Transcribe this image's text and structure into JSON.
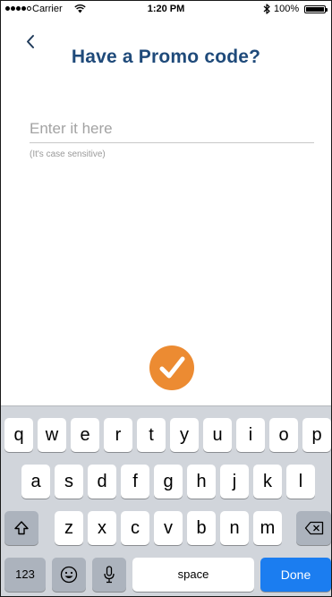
{
  "status_bar": {
    "carrier": "Carrier",
    "time": "1:20 PM",
    "battery": "100%",
    "signal_icon": "signal-dots-icon",
    "wifi_icon": "wifi-icon",
    "bluetooth_icon": "bluetooth-icon",
    "battery_icon": "battery-icon"
  },
  "header": {
    "back_icon": "chevron-left-icon",
    "title": "Have a Promo code?"
  },
  "promo": {
    "placeholder": "Enter it here",
    "value": "",
    "helper": "(It's case sensitive)"
  },
  "submit": {
    "icon": "checkmark-icon",
    "color": "#ec8b32"
  },
  "keyboard": {
    "row1": [
      "q",
      "w",
      "e",
      "r",
      "t",
      "y",
      "u",
      "i",
      "o",
      "p"
    ],
    "row2": [
      "a",
      "s",
      "d",
      "f",
      "g",
      "h",
      "j",
      "k",
      "l"
    ],
    "row3": [
      "z",
      "x",
      "c",
      "v",
      "b",
      "n",
      "m"
    ],
    "shift_icon": "shift-arrow-icon",
    "delete_icon": "backspace-icon",
    "numbers_label": "123",
    "emoji_icon": "emoji-icon",
    "mic_icon": "microphone-icon",
    "space_label": "space",
    "done_label": "Done",
    "done_color": "#1b7df0"
  },
  "colors": {
    "title": "#1f4a7a",
    "accent": "#ec8b32",
    "keyboard_bg": "#d1d5db"
  }
}
